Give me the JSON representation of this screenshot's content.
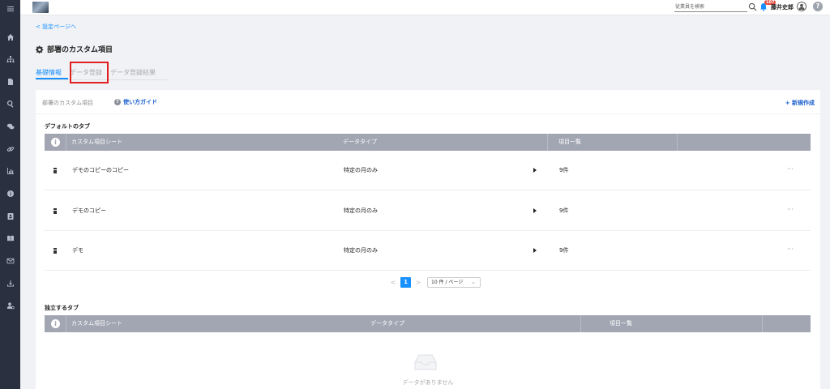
{
  "sidebar": {
    "icons": [
      "menu-icon",
      "home-icon",
      "org-chart-icon",
      "document-icon",
      "search-icon",
      "chat-icon",
      "link-icon",
      "chart-icon",
      "info-circle-icon",
      "contact-card-icon",
      "book-icon",
      "mail-icon",
      "download-icon",
      "user-settings-icon"
    ]
  },
  "topbar": {
    "search_placeholder": "従業員を検索",
    "notification_count": "107",
    "username": "藤井史郎",
    "help": "?"
  },
  "page": {
    "back_link": "< 設定ページへ",
    "title": "部署のカスタム項目",
    "tabs": [
      {
        "label": "基礎情報",
        "active": true
      },
      {
        "label": "データ登録",
        "active": false
      },
      {
        "label": "データ登録結果",
        "active": false
      }
    ]
  },
  "card": {
    "title": "部署のカスタム項目",
    "guide_label": "使い方ガイド",
    "new_label": "+ 新規作成"
  },
  "default_tabs": {
    "label": "デフォルトのタブ",
    "columns": [
      "カスタム項目シート",
      "データタイプ",
      "項目一覧"
    ],
    "rows": [
      {
        "name": "デモのコピーのコピー",
        "type": "特定の月のみ",
        "count": "9件",
        "menu": "···"
      },
      {
        "name": "デモのコピー",
        "type": "特定の月のみ",
        "count": "9件",
        "menu": "···"
      },
      {
        "name": "デモ",
        "type": "特定の月のみ",
        "count": "9件",
        "menu": "···"
      }
    ],
    "pagination": {
      "prev": "<",
      "page": "1",
      "next": ">",
      "page_size": "10 件 / ページ"
    }
  },
  "independent_tabs": {
    "label": "独立するタブ",
    "columns": [
      "カスタム項目シート",
      "データタイプ",
      "項目一覧"
    ],
    "empty_text": "データがありません"
  },
  "colors": {
    "sidebar_bg": "#2b3040",
    "accent": "#1890ff",
    "table_header": "#a2a5b2",
    "highlight": "#e02020"
  }
}
